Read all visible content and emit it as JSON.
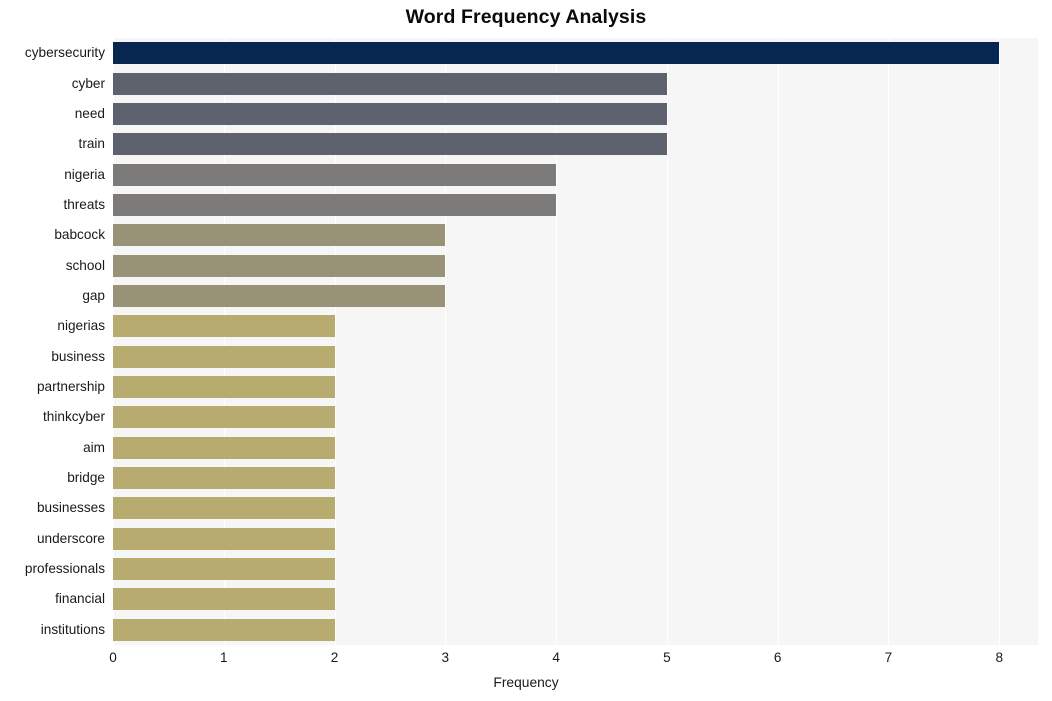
{
  "chart_data": {
    "type": "bar",
    "orientation": "horizontal",
    "title": "Word Frequency Analysis",
    "xlabel": "Frequency",
    "ylabel": "",
    "xlim": [
      0,
      8.35
    ],
    "ylim": [
      0,
      20
    ],
    "xticks": [
      "0",
      "1",
      "2",
      "3",
      "4",
      "5",
      "6",
      "7",
      "8"
    ],
    "xtick_values": [
      0,
      1,
      2,
      3,
      4,
      5,
      6,
      7,
      8
    ],
    "grid": "vertical-white-gridlines",
    "legend": "none",
    "categories": [
      "cybersecurity",
      "cyber",
      "need",
      "train",
      "nigeria",
      "threats",
      "babcock",
      "school",
      "gap",
      "nigerias",
      "business",
      "partnership",
      "thinkcyber",
      "aim",
      "bridge",
      "businesses",
      "underscore",
      "professionals",
      "financial",
      "institutions"
    ],
    "values": [
      8,
      5,
      5,
      5,
      4,
      4,
      3,
      3,
      3,
      2,
      2,
      2,
      2,
      2,
      2,
      2,
      2,
      2,
      2,
      2
    ],
    "bar_colors": [
      "#082750",
      "#5d626e",
      "#5d626e",
      "#5d626e",
      "#7c7b79",
      "#7c7b79",
      "#989277",
      "#989277",
      "#989277",
      "#b8ab6f",
      "#b8ab6f",
      "#b8ab6f",
      "#b8ab6f",
      "#b8ab6f",
      "#b8ab6f",
      "#b8ab6f",
      "#b8ab6f",
      "#b8ab6f",
      "#b8ab6f",
      "#b8ab6f"
    ],
    "plot_background": "#f6f6f7",
    "figure_background": "#ffffff",
    "gridline_color": "#ffffff"
  }
}
